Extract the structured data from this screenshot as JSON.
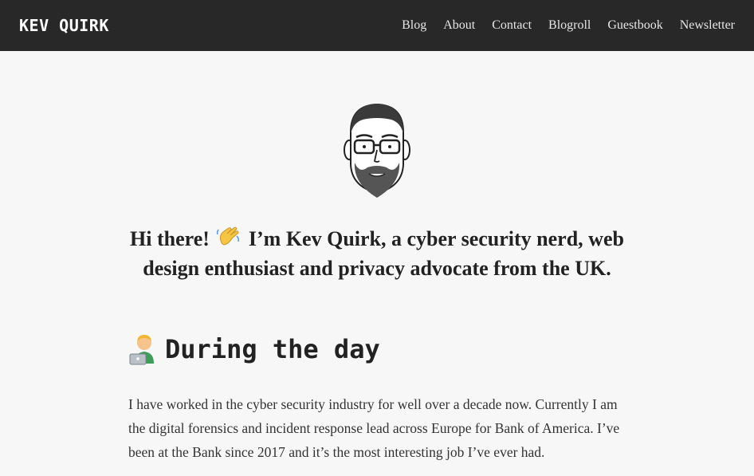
{
  "header": {
    "brand": "KEV QUIRK",
    "nav": [
      "Blog",
      "About",
      "Contact",
      "Blogroll",
      "Guestbook",
      "Newsletter"
    ]
  },
  "hero": {
    "avatar_icon": "cartoon-face-avatar",
    "intro_greeting": "Hi there!",
    "intro_emoji": "waving-hand-icon",
    "intro_text": "I’m Kev Quirk, a cyber security nerd, web design enthusiast and privacy advocate from the UK."
  },
  "section": {
    "icon": "technologist-icon",
    "title": "During the day",
    "paragraph": "I have worked in the cyber security industry for well over a decade now. Currently I am the digital forensics and incident response lead across Europe for Bank of America. I’ve been at the Bank since 2017 and it’s the most interesting job I’ve ever had."
  },
  "colors": {
    "header_bg": "#282828",
    "page_bg": "#f7f7f7",
    "text": "#333333"
  }
}
